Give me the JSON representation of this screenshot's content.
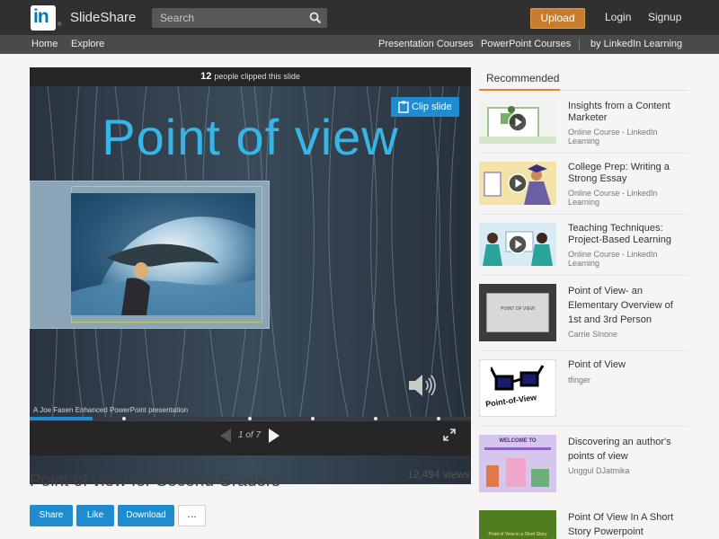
{
  "header": {
    "logo_text": "in",
    "brand": "SlideShare",
    "search_placeholder": "Search",
    "upload": "Upload",
    "login": "Login",
    "signup": "Signup"
  },
  "nav": {
    "home": "Home",
    "explore": "Explore",
    "presentation_courses": "Presentation Courses",
    "powerpoint_courses": "PowerPoint Courses",
    "by_linkedin": "by LinkedIn Learning"
  },
  "player": {
    "clip_count": "12",
    "clip_text": "people clipped this slide",
    "clip_button": "Clip slide",
    "slide_title": "Point of view",
    "slide_caption": "A Joe Fasen Enhanced PowerPoint presentation",
    "page_indicator": "1 of 7",
    "progress": 0.143
  },
  "presentation": {
    "title": "Point of view for Second Graders",
    "views": "12,494 views",
    "share": "Share",
    "like": "Like",
    "download": "Download",
    "more": "..."
  },
  "recommended": {
    "heading": "Recommended",
    "items": [
      {
        "title": "Insights from a Content Marketer",
        "sub": "Online Course - LinkedIn Learning"
      },
      {
        "title": "College Prep: Writing a Strong Essay",
        "sub": "Online Course - LinkedIn Learning"
      },
      {
        "title": "Teaching Techniques: Project-Based Learning",
        "sub": "Online Course - LinkedIn Learning"
      },
      {
        "title": "Point of View- an Elementary Overview of 1st and 3rd Person",
        "sub": "Carrie Slnone",
        "thumb_text": "POINT OF VIEW"
      },
      {
        "title": "Point of View",
        "sub": "tfinger",
        "thumb_text": "Point-of-View"
      },
      {
        "title": "Discovering an author's points of view",
        "sub": "Unggul DJatmika",
        "thumb_text": "WELCOME TO"
      },
      {
        "title": "Point Of View In A Short Story Powerpoint",
        "sub": "",
        "thumb_text": "Point of View in a Short Story"
      }
    ]
  },
  "colors": {
    "accent": "#1e8ccf",
    "upload": "#c77c2e",
    "slide_title": "#36b6e6"
  }
}
